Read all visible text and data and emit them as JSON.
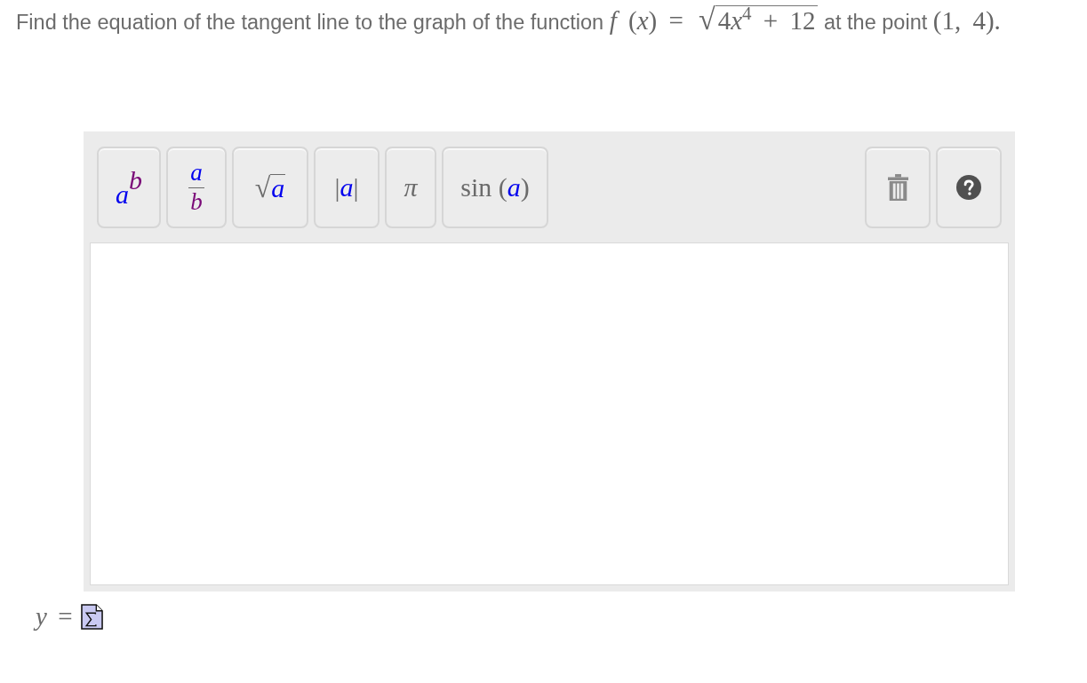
{
  "question": {
    "segments": [
      {
        "kind": "text",
        "text": "Find the equation of the tangent line to the graph of the function "
      },
      {
        "kind": "math",
        "text": "*f* (*x*) = "
      },
      {
        "kind": "sqrt",
        "radical": "√",
        "parts": [
          "4",
          "*x*$^{4}$ + 12"
        ]
      },
      {
        "kind": "text",
        "text": " at the point "
      },
      {
        "kind": "math",
        "text": "(1, 4)."
      }
    ]
  },
  "editor": {
    "buttons": [
      {
        "kind": "power",
        "base": "a",
        "exponent": "b"
      },
      {
        "kind": "fraction",
        "numerator": "a",
        "denominator": "b"
      },
      {
        "kind": "sqrt",
        "radical": "√",
        "radicand": "a"
      },
      {
        "kind": "abs",
        "left": "|",
        "inner": "a",
        "right": "|"
      },
      {
        "kind": "symbol",
        "text": "π"
      },
      {
        "kind": "function",
        "name": "sin",
        "open": "(",
        "arg": "a",
        "close": ")"
      }
    ],
    "tools": [
      {
        "kind": "trash"
      },
      {
        "kind": "help"
      }
    ]
  },
  "answer": {
    "label": "*y* ="
  }
}
